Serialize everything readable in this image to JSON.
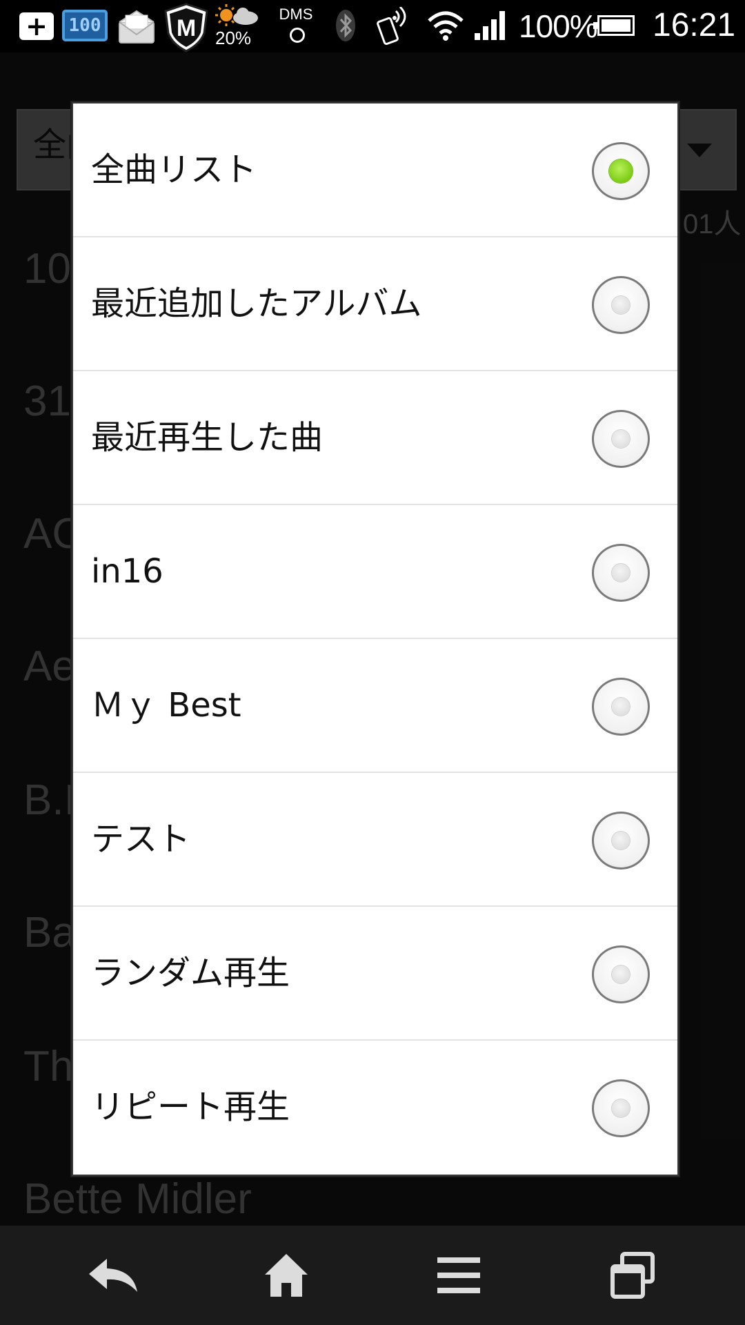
{
  "status_bar": {
    "battery_widget_text": "100",
    "weather_temp": "20%",
    "dms_label": "DMS",
    "battery_percent": "100%",
    "time": "16:21",
    "icons": [
      "add-icon",
      "battery-widget-icon",
      "mail-icon",
      "shield-icon",
      "weather-icon",
      "dms-icon",
      "bluetooth-icon",
      "nfc-icon",
      "wifi-icon",
      "signal-icon",
      "battery-icon"
    ]
  },
  "background": {
    "spinner_label": "全曲リスト",
    "count_text": "01人",
    "artists": [
      "10",
      "31",
      "AC",
      "Ae",
      "B.I",
      "Ba",
      "Th",
      "Bette Midler"
    ]
  },
  "dialog": {
    "selected_index": 0,
    "options": [
      {
        "label": "全曲リスト"
      },
      {
        "label": "最近追加したアルバム"
      },
      {
        "label": "最近再生した曲"
      },
      {
        "label": "in16"
      },
      {
        "label": "Ｍｙ Best"
      },
      {
        "label": "テスト"
      },
      {
        "label": "ランダム再生"
      },
      {
        "label": "リピート再生"
      }
    ]
  },
  "nav_bar": {
    "buttons": [
      "back-icon",
      "home-icon",
      "menu-icon",
      "recent-apps-icon"
    ]
  },
  "colors": {
    "radio_selected": "#7ccc14",
    "dialog_bg": "#ffffff",
    "nav_bg": "#1b1b1b"
  }
}
